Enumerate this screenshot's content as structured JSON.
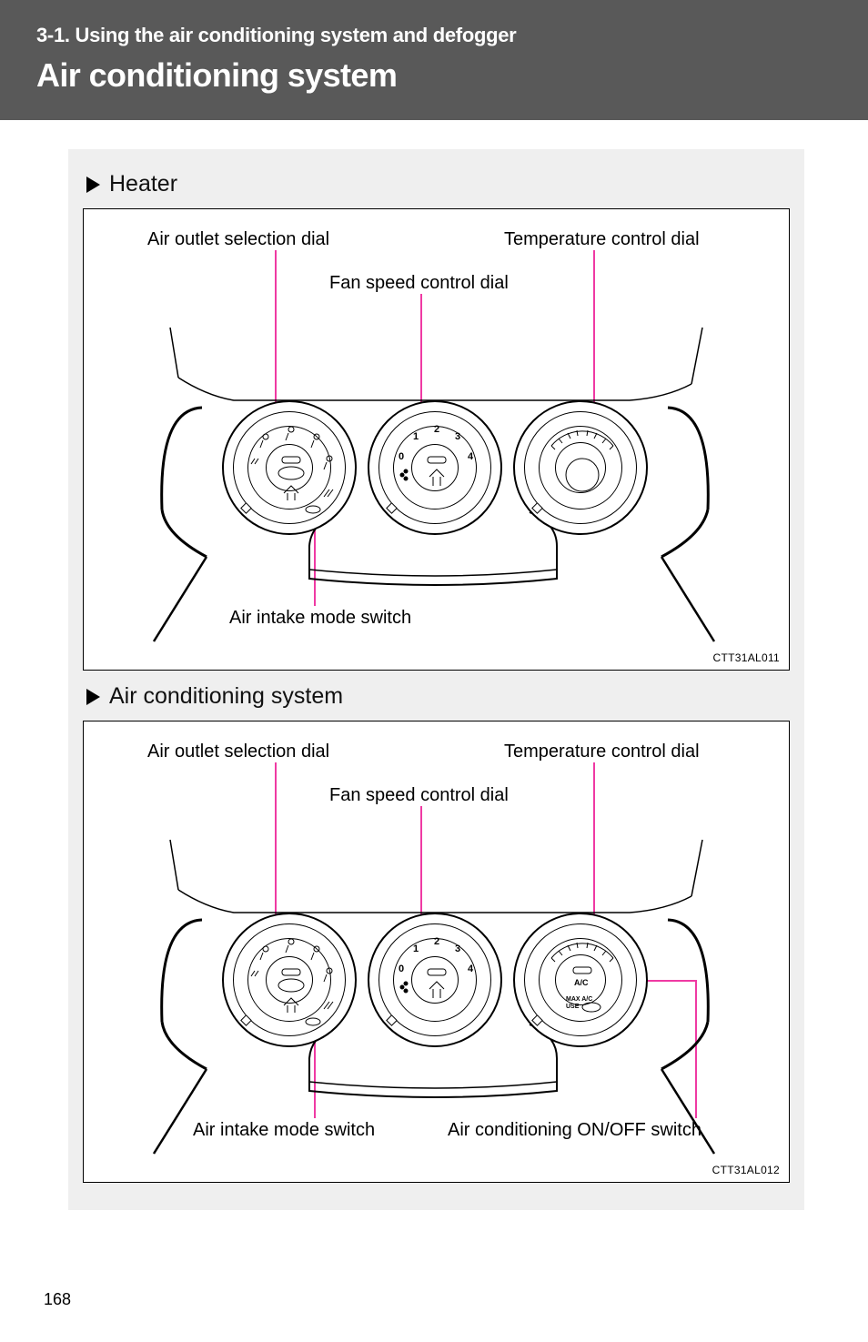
{
  "header": {
    "subtitle": "3-1. Using the air conditioning system and defogger",
    "title": "Air conditioning system"
  },
  "sections": {
    "heater_label": "Heater",
    "ac_label": "Air conditioning system"
  },
  "callouts": {
    "air_outlet": "Air outlet selection dial",
    "temp_control": "Temperature control dial",
    "fan_speed": "Fan speed control dial",
    "air_intake": "Air intake mode switch",
    "ac_onoff": "Air conditioning ON/OFF switch"
  },
  "fan_dial": {
    "positions": [
      "0",
      "1",
      "2",
      "3",
      "4"
    ]
  },
  "ac_button": {
    "label": "A/C",
    "sub": "MAX A/C",
    "sub2": "USE"
  },
  "fig_codes": {
    "heater": "CTT31AL011",
    "ac": "CTT31AL012"
  },
  "page_number": "168"
}
